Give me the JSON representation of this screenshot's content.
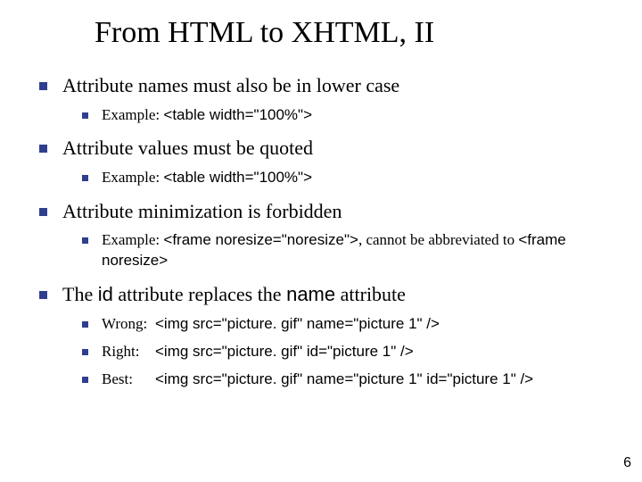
{
  "title": "From HTML to XHTML, II",
  "bullets": {
    "b1": {
      "text": "Attribute names must also be in lower case",
      "ex_label": "Example: ",
      "ex_code": "<table width=\"100%\">"
    },
    "b2": {
      "text": "Attribute values must be quoted",
      "ex_label": "Example: ",
      "ex_code": "<table width=\"100%\">"
    },
    "b3": {
      "text": "Attribute minimization is forbidden",
      "ex_label": "Example: ",
      "ex_code1": "<frame noresize=\"noresize\">",
      "ex_mid": ", cannot be abbreviated to ",
      "ex_code2": "<frame noresize>"
    },
    "b4": {
      "pre": "The ",
      "id_word": "id",
      "mid": " attribute replaces the ",
      "name_word": "name",
      "post": " attribute",
      "rows": {
        "wrong": {
          "label": "Wrong:",
          "code": "<img src=\"picture. gif\" name=\"picture 1\" />"
        },
        "right": {
          "label": "Right:",
          "code": "<img src=\"picture. gif\" id=\"picture 1\" />"
        },
        "best": {
          "label": "Best:",
          "code": "<img src=\"picture. gif\" name=\"picture 1\" id=\"picture 1\" />"
        }
      }
    }
  },
  "page_number": "6"
}
